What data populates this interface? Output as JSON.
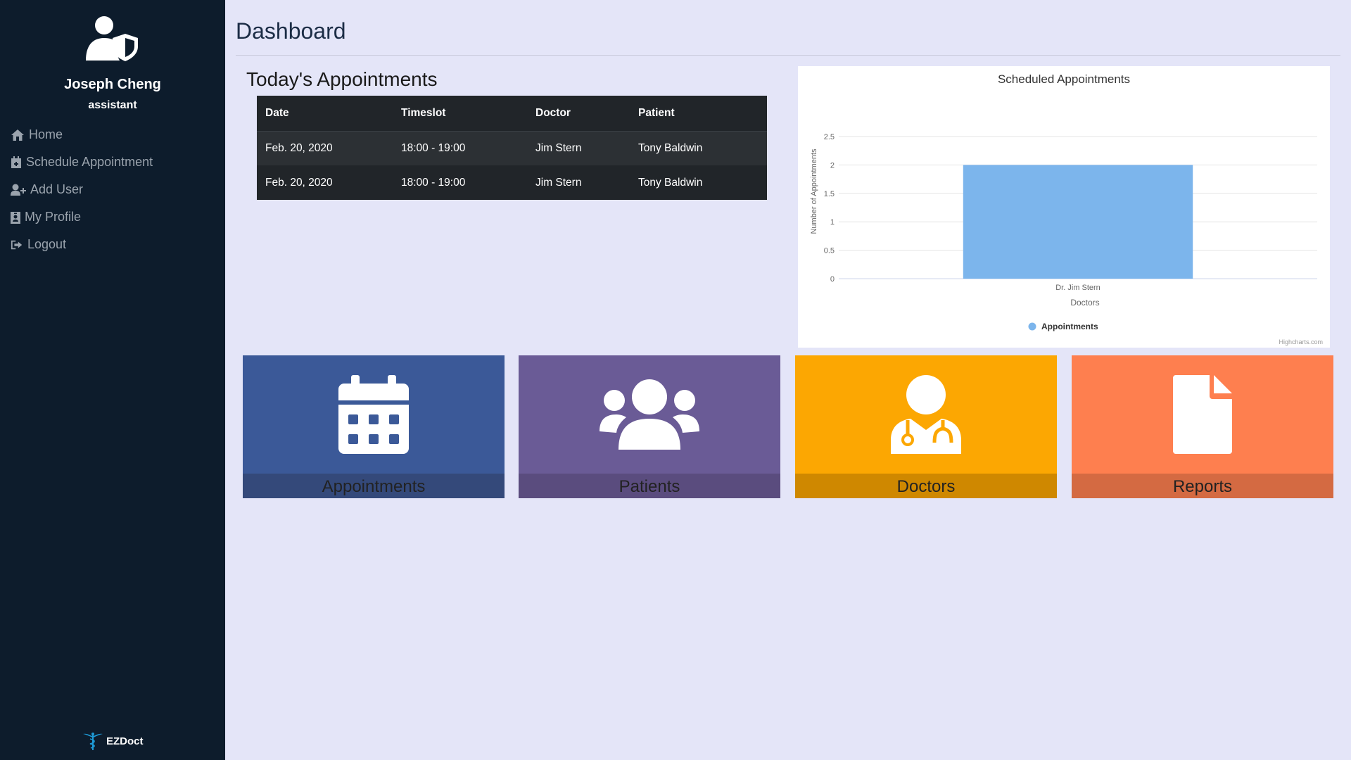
{
  "user": {
    "name": "Joseph Cheng",
    "role": "assistant"
  },
  "nav": [
    {
      "label": "Home",
      "icon": "home-icon"
    },
    {
      "label": "Schedule Appointment",
      "icon": "calendar-plus-icon"
    },
    {
      "label": "Add User",
      "icon": "user-plus-icon"
    },
    {
      "label": "My Profile",
      "icon": "id-badge-icon"
    },
    {
      "label": "Logout",
      "icon": "sign-out-icon"
    }
  ],
  "brand": {
    "name": "EZDoct",
    "icon": "caduceus-icon"
  },
  "page": {
    "title": "Dashboard"
  },
  "appointments": {
    "heading": "Today's Appointments",
    "columns": [
      "Date",
      "Timeslot",
      "Doctor",
      "Patient"
    ],
    "rows": [
      [
        "Feb. 20, 2020",
        "18:00 - 19:00",
        "Jim Stern",
        "Tony Baldwin"
      ],
      [
        "Feb. 20, 2020",
        "18:00 - 19:00",
        "Jim Stern",
        "Tony Baldwin"
      ]
    ]
  },
  "chart_data": {
    "type": "bar",
    "title": "Scheduled Appointments",
    "categories": [
      "Dr. Jim Stern"
    ],
    "series": [
      {
        "name": "Appointments",
        "values": [
          2
        ],
        "color": "#7cb5ec"
      }
    ],
    "xlabel": "Doctors",
    "ylabel": "Number of Appointments",
    "ylim": [
      0,
      2.5
    ],
    "yticks": [
      "0",
      "0.5",
      "1",
      "1.5",
      "2",
      "2.5"
    ],
    "grid": true,
    "legend": "bottom-center",
    "credits": "Highcharts.com"
  },
  "tiles": [
    {
      "label": "Appointments",
      "icon": "calendar-icon",
      "color": "#3b5998",
      "footer_color": "#34497a"
    },
    {
      "label": "Patients",
      "icon": "users-icon",
      "color": "#6a5b96",
      "footer_color": "#5a4c7e"
    },
    {
      "label": "Doctors",
      "icon": "user-md-icon",
      "color": "#fca702",
      "footer_color": "#cf8800"
    },
    {
      "label": "Reports",
      "icon": "file-icon",
      "color": "#fe7f4f",
      "footer_color": "#d46a42"
    }
  ]
}
